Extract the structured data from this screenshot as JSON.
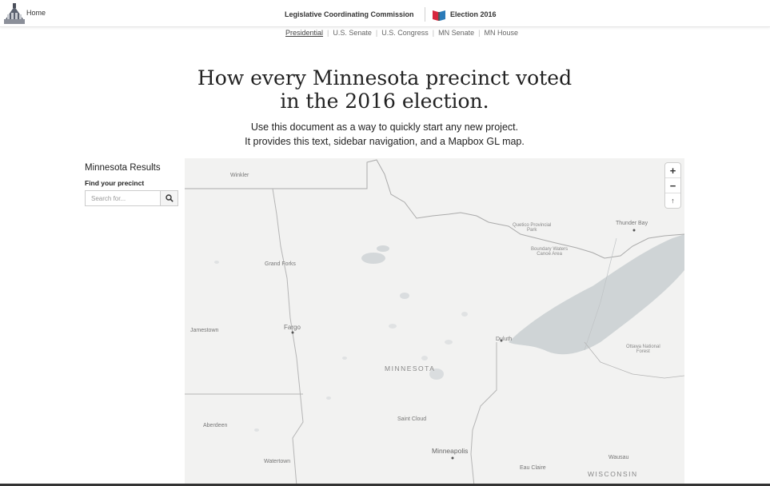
{
  "header": {
    "home_label": "Home",
    "org_title": "Legislative Coordinating Commission",
    "election_title": "Election 2016"
  },
  "subnav": {
    "items": [
      {
        "label": "Presidential",
        "active": true
      },
      {
        "label": "U.S. Senate",
        "active": false
      },
      {
        "label": "U.S. Congress",
        "active": false
      },
      {
        "label": "MN Senate",
        "active": false
      },
      {
        "label": "MN House",
        "active": false
      }
    ]
  },
  "hero": {
    "title_line1": "How every Minnesota precinct voted",
    "title_line2": "in the 2016 election.",
    "subtitle_line1": "Use this document as a way to quickly start any new project.",
    "subtitle_line2": "It provides this text, sidebar navigation, and a Mapbox GL map."
  },
  "sidebar": {
    "title": "Minnesota Results",
    "find_label": "Find your precinct",
    "search_placeholder": "Search for..."
  },
  "map": {
    "labels": {
      "winkler": "Winkler",
      "grand_forks": "Grand Forks",
      "jamestown": "Jamestown",
      "fargo": "Fargo",
      "aberdeen": "Aberdeen",
      "watertown": "Watertown",
      "minnesota": "MINNESOTA",
      "saint_cloud": "Saint Cloud",
      "minneapolis": "Minneapolis",
      "duluth": "Duluth",
      "eau_claire": "Eau Claire",
      "wausau": "Wausau",
      "wisconsin": "WISCONSIN",
      "thunder_bay": "Thunder Bay",
      "quetico_1": "Quetico Provincial",
      "quetico_2": "Park",
      "boundary_1": "Boundary Waters",
      "boundary_2": "Canoe Area",
      "ottawa_1": "Ottawa National",
      "ottawa_2": "Forest"
    },
    "controls": {
      "zoom_in": "+",
      "zoom_out": "−",
      "compass": "↑"
    }
  },
  "colors": {
    "map_land": "#f2f2f1",
    "map_water": "#cfd4d6",
    "border": "#aaaaaa",
    "brand_red": "#d7263d",
    "brand_blue": "#2b7bb9"
  }
}
